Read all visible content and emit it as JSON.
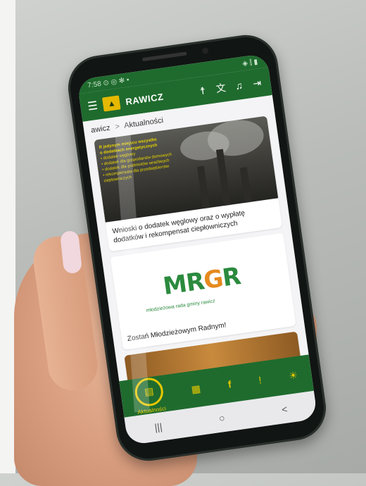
{
  "status_bar": {
    "time": "7:58",
    "icons_left": "⊙ ◎ ✻ •",
    "icons_right": "◈ ⫿ ▮"
  },
  "app_bar": {
    "brand": "RAWICZ",
    "logo_glyph": "▲",
    "icons": [
      "menu-icon",
      "accessibility-icon",
      "translate-icon",
      "bell-icon",
      "login-icon"
    ]
  },
  "breadcrumb": {
    "root": "awicz",
    "separator": ">",
    "current": "Aktualności"
  },
  "cards": [
    {
      "image_text": [
        "R jedynym miejscu wszystko",
        "o dodatkach energetycznych",
        "• dodatek węglowy",
        "• dodatek dla gospodarstw domowych",
        "• dodatek dla podmiotów wrażliwych",
        "• rekompensata dla przedsiębiorstw",
        "  ciepłowniczych"
      ],
      "title": "Wnioski o dodatek węglowy oraz o wypłatę dodatków i rekompensat ciepłowniczych"
    },
    {
      "logo": {
        "m": "M",
        "r1": "R",
        "g": "G",
        "r2": "R"
      },
      "logo_subtitle": "młodzieżowa rada gminy rawicz",
      "title": "Zostań Młodzieżowym Radnym!"
    },
    {
      "title": ""
    }
  ],
  "bottom_nav": {
    "items": [
      {
        "icon": "news-icon",
        "glyph": "▤",
        "label": "Aktualności",
        "active": true
      },
      {
        "icon": "calendar-icon",
        "glyph": "▦",
        "label": ""
      },
      {
        "icon": "facebook-icon",
        "glyph": "f",
        "label": ""
      },
      {
        "icon": "alert-icon",
        "glyph": "!",
        "label": ""
      },
      {
        "icon": "sun-icon",
        "glyph": "☀",
        "label": ""
      }
    ]
  },
  "system_nav": {
    "recents": "|||",
    "home": "○",
    "back": "<"
  },
  "colors": {
    "brand_green": "#1f6b2e",
    "accent_yellow": "#e6c700",
    "logo_green": "#2b8a3e",
    "logo_orange": "#e58a1f"
  }
}
